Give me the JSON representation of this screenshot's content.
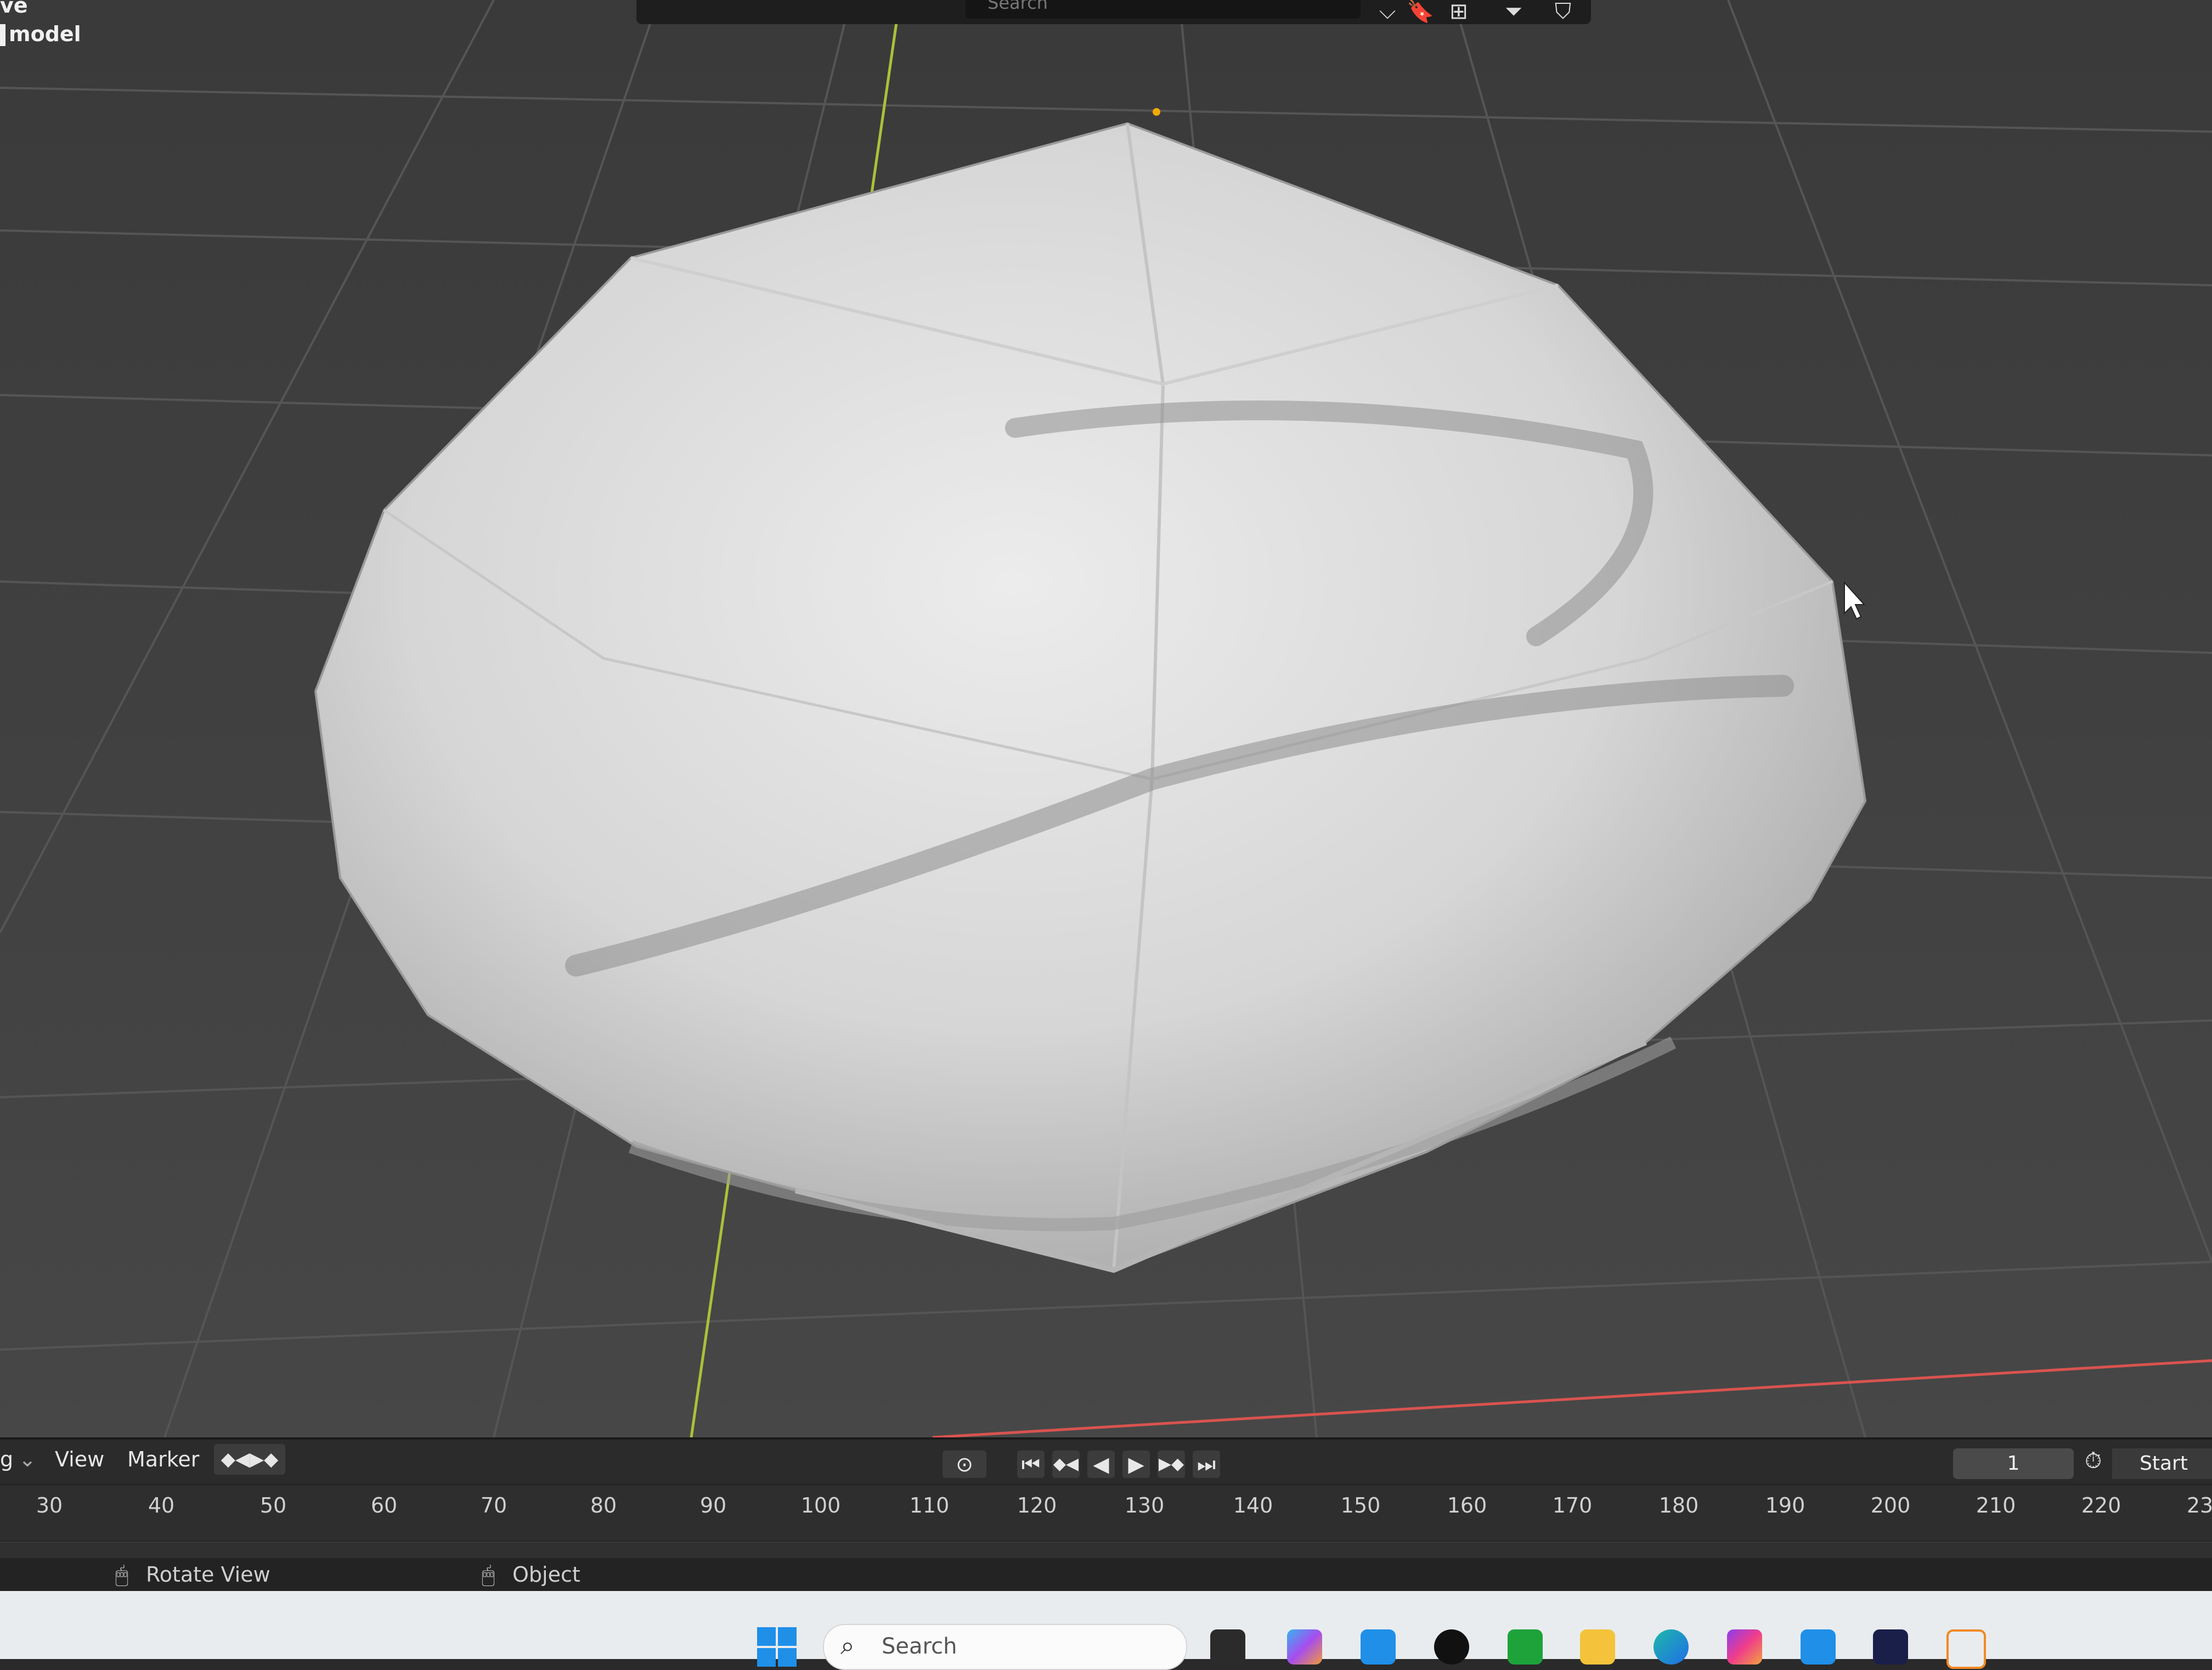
{
  "overlay": {
    "top_left_mode_fragment": "ve",
    "object_name": "model"
  },
  "header": {
    "search_placeholder": "Search",
    "icons": [
      "bookmark-icon",
      "layout-icon",
      "filter-icon",
      "shield-check-icon"
    ]
  },
  "timeline": {
    "menu": {
      "playback_fragment": "g",
      "view": "View",
      "marker": "Marker"
    },
    "ticks": [
      "30",
      "40",
      "50",
      "60",
      "70",
      "80",
      "90",
      "100",
      "110",
      "120",
      "130",
      "140",
      "150",
      "160",
      "170",
      "180",
      "190",
      "200",
      "210",
      "220",
      "23"
    ],
    "current_frame": "1",
    "start_label": "Start",
    "playback_icons": {
      "jump_start": "⏮",
      "prev_key": "◆◀",
      "play_reverse": "◀",
      "play": "▶",
      "next_key": "▶◆",
      "jump_end": "⏭"
    }
  },
  "status_bar": {
    "hint_left": "Rotate View",
    "hint_right": "Object"
  },
  "taskbar": {
    "search_placeholder": "Search",
    "apps": [
      "windows-start-icon",
      "task-view-icon",
      "copilot-icon",
      "store-icon",
      "media-icon",
      "xbox-icon",
      "file-explorer-icon",
      "edge-icon",
      "instagram-icon",
      "photos-icon",
      "creative-app-icon",
      "blender-icon"
    ]
  },
  "colors": {
    "viewport_bg": "#3f3f3f",
    "grid_line": "#4f4f4f",
    "axis_x": "#d9534f",
    "axis_y": "#a8c23a",
    "mesh_light": "#e3e3e3",
    "mesh_shade": "#b9b9b9",
    "taskbar_bg": "#e9ecef"
  }
}
